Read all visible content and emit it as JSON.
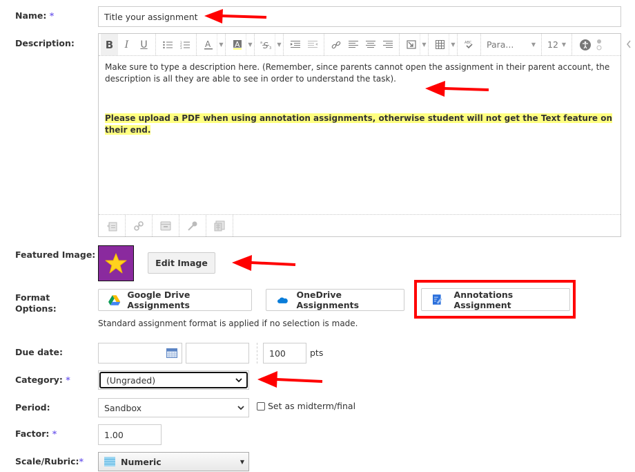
{
  "name": {
    "label": "Name:",
    "required": "*",
    "value": "Title your assignment"
  },
  "description": {
    "label": "Description:",
    "toolbar": {
      "bold": "B",
      "italic": "I",
      "underline": "U",
      "paragraph_format": "Para...",
      "font_size": "12",
      "icons": [
        "bold-icon",
        "italic-icon",
        "underline-icon",
        "bulleted-list-icon",
        "numbered-list-icon",
        "font-color-icon",
        "highlight-color-icon",
        "superscript-subscript-icon",
        "indent-icon",
        "outdent-icon",
        "link-icon",
        "align-left-icon",
        "align-center-icon",
        "align-right-icon",
        "insert-media-icon",
        "table-icon",
        "spellcheck-icon",
        "accessibility-icon",
        "more-icon",
        "collapse-icon"
      ]
    },
    "content": {
      "paragraph1": "Make sure to type a description here. (Remember, since parents cannot open the assignment in their parent account, the description is all they are able to see in order to understand the task).",
      "paragraph2": "Please upload a PDF when using annotation assignments, otherwise student will not get the Text feature on their end."
    },
    "bottom_icons": [
      "insert-content-icon",
      "insert-link-icon",
      "insert-file-icon",
      "record-audio-icon",
      "insert-resource-icon"
    ]
  },
  "featured_image": {
    "label": "Featured Image:",
    "edit_button": "Edit Image",
    "colors": {
      "background": "#8a2a9e",
      "star": "#ffd21e"
    }
  },
  "format_options": {
    "label_line1": "Format",
    "label_line2": "Options:",
    "options": [
      {
        "label": "Google Drive Assignments",
        "icon": "google-drive-icon"
      },
      {
        "label": "OneDrive Assignments",
        "icon": "onedrive-icon"
      },
      {
        "label": "Annotations Assignment",
        "icon": "annotations-icon"
      }
    ],
    "hint": "Standard assignment format is applied if no selection is made."
  },
  "due_date": {
    "label": "Due date:",
    "date_value": "",
    "time_value": "",
    "points": "100",
    "points_unit": "pts"
  },
  "category": {
    "label": "Category:",
    "required": "*",
    "selected": "(Ungraded)"
  },
  "period": {
    "label": "Period:",
    "selected": "Sandbox",
    "midterm_checkbox_label": "Set as midterm/final",
    "midterm_checked": false
  },
  "factor": {
    "label": "Factor:",
    "required": "*",
    "value": "1.00"
  },
  "scale": {
    "label": "Scale/Rubric:",
    "required": "*",
    "selected": "Numeric"
  },
  "annotations": {
    "arrow_color": "#ff0000",
    "highlight_box_color": "#ff0000"
  }
}
